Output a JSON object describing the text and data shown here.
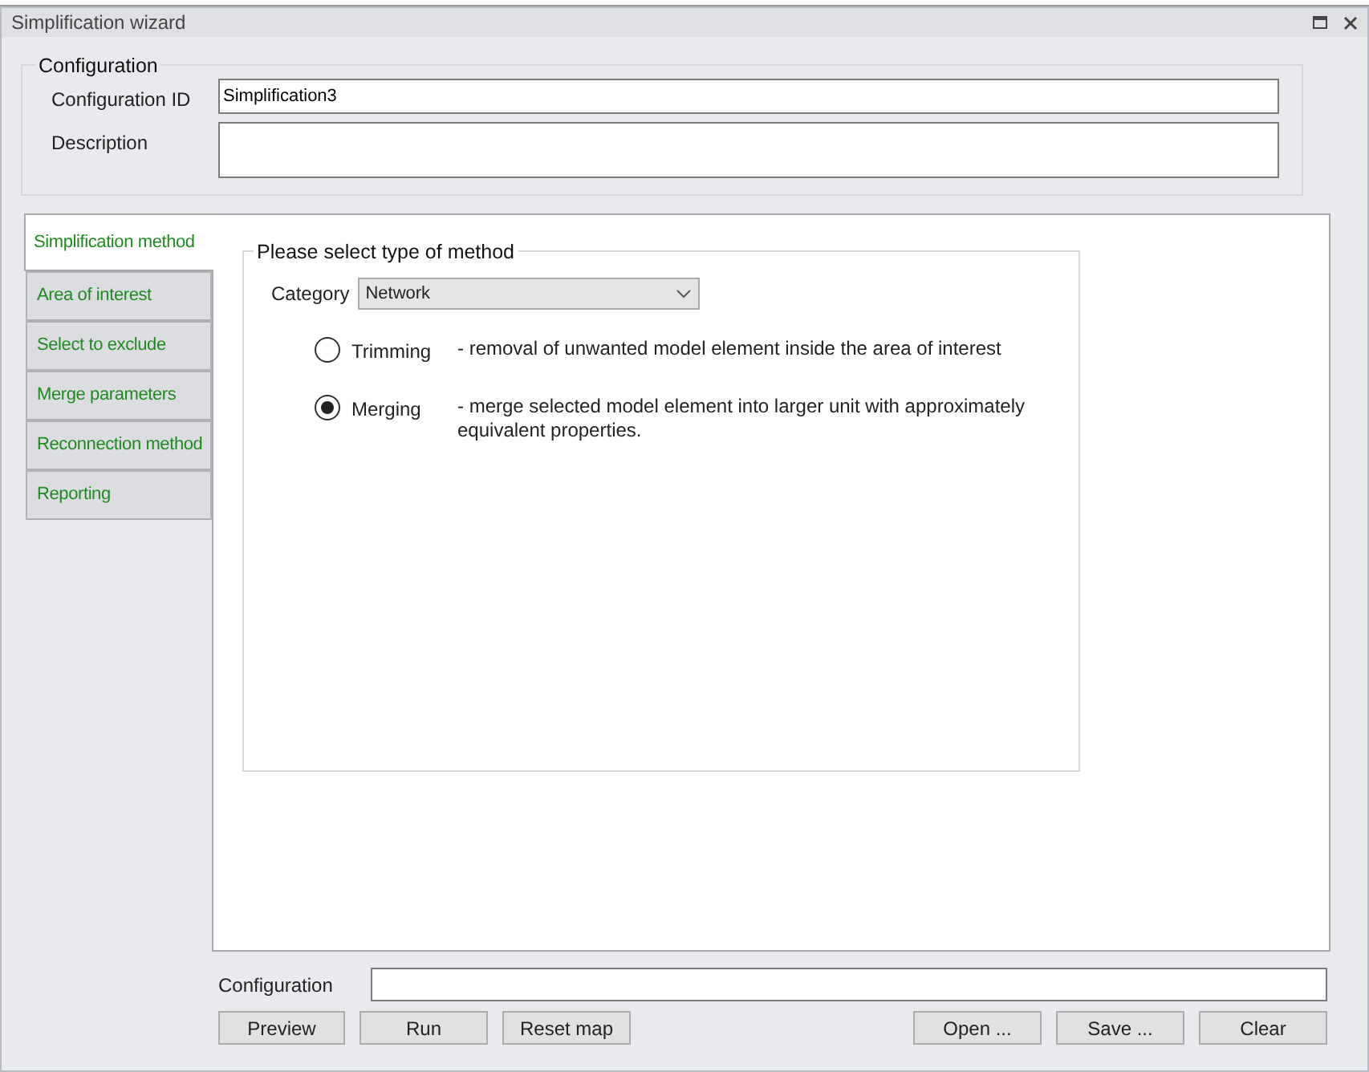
{
  "window": {
    "title": "Simplification wizard"
  },
  "configuration": {
    "legend": "Configuration",
    "id_label": "Configuration ID",
    "id_value": "Simplification3",
    "description_label": "Description"
  },
  "tabs": [
    {
      "label": "Simplification method",
      "selected": true
    },
    {
      "label": "Area of interest",
      "selected": false
    },
    {
      "label": "Select to exclude",
      "selected": false
    },
    {
      "label": "Merge parameters",
      "selected": false
    },
    {
      "label": "Reconnection method",
      "selected": false
    },
    {
      "label": "Reporting",
      "selected": false
    }
  ],
  "method_group": {
    "legend": "Please select type of method",
    "category_label": "Category",
    "category_value": "Network",
    "options": [
      {
        "label": "Trimming",
        "description": "- removal of unwanted model element inside the area of interest",
        "selected": false
      },
      {
        "label": "Merging",
        "description": "- merge selected model element into larger unit with approximately equivalent properties.",
        "selected": true
      }
    ]
  },
  "footer": {
    "configuration_label": "Configuration",
    "buttons_left": [
      "Preview",
      "Run",
      "Reset map"
    ],
    "buttons_right": [
      "Open ...",
      "Save ...",
      "Clear"
    ]
  }
}
